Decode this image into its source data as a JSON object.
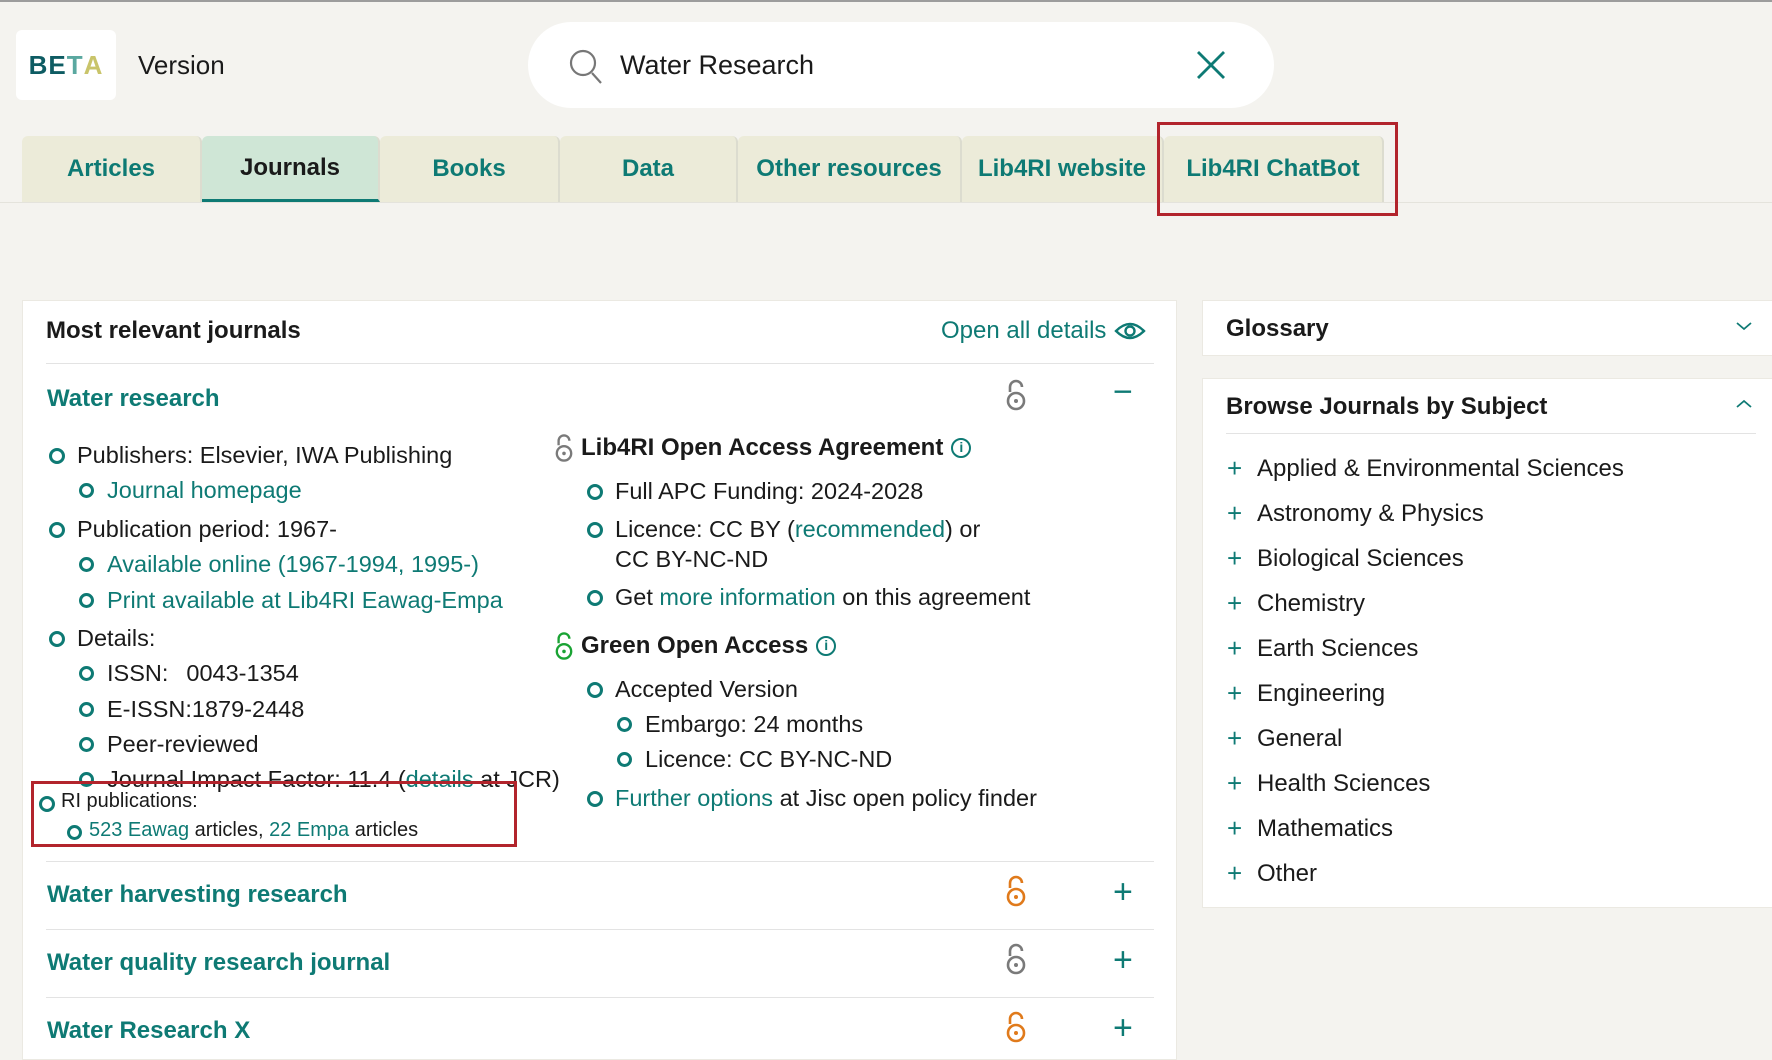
{
  "header": {
    "beta_letters": [
      "BE",
      "T",
      "A"
    ],
    "version_label": "Version",
    "search_query": "Water Research"
  },
  "tabs": [
    {
      "label": "Articles"
    },
    {
      "label": "Journals"
    },
    {
      "label": "Books"
    },
    {
      "label": "Data"
    },
    {
      "label": "Other resources"
    },
    {
      "label": "Lib4RI website"
    },
    {
      "label": "Lib4RI ChatBot"
    }
  ],
  "journals_panel": {
    "title": "Most relevant journals",
    "open_all": "Open all details",
    "expanded": {
      "title": "Water research",
      "publishers": "Publishers: Elsevier, IWA Publishing",
      "journal_homepage": "Journal homepage",
      "publication_period": "Publication period: 1967-",
      "available_online": "Available online (1967-1994, 1995-)",
      "print_available": "Print available at Lib4RI Eawag-Empa",
      "details": "Details:",
      "issn_label": "ISSN:",
      "issn": "0043-1354",
      "eissn_label": "E-ISSN:",
      "eissn": "1879-2448",
      "peer": "Peer-reviewed",
      "jif_pre": "Journal Impact Factor: 11.4 (",
      "jif_link": "details",
      "jif_post": " at JCR)",
      "ri_pubs": "RI publications:",
      "eawag_link": "523 Eawag",
      "eawag_post": " articles, ",
      "empa_link": "22 Empa",
      "empa_post": " articles",
      "oa_agreement_title": "Lib4RI Open Access Agreement",
      "apc": "Full APC Funding: 2024-2028",
      "licence_pre": "Licence: CC BY (",
      "licence_link": "recommended",
      "licence_post": ") or",
      "licence_line2": "CC BY-NC-ND",
      "get_pre": "Get ",
      "get_link": "more information",
      "get_post": " on this agreement",
      "green_title": "Green Open Access",
      "accepted": "Accepted Version",
      "embargo": "Embargo: 24 months",
      "green_licence": "Licence: CC BY-NC-ND",
      "further_link": "Further options",
      "further_post": " at Jisc open policy finder"
    },
    "collapsed": [
      {
        "title": "Water harvesting research",
        "oa_color": "#e07a1b"
      },
      {
        "title": "Water quality research journal",
        "oa_color": "#7a7a7a"
      },
      {
        "title": "Water Research X",
        "oa_color": "#e07a1b"
      }
    ]
  },
  "sidebar": {
    "glossary_title": "Glossary",
    "browse_title": "Browse Journals by Subject",
    "subjects": [
      "Applied & Environmental Sciences",
      "Astronomy & Physics",
      "Biological Sciences",
      "Chemistry",
      "Earth Sciences",
      "Engineering",
      "General",
      "Health Sciences",
      "Mathematics",
      "Other"
    ]
  },
  "colors": {
    "accent": "#0e7a74",
    "highlight": "#b2242c",
    "green_oa": "#1aa334",
    "gold_oa": "#e07a1b"
  }
}
